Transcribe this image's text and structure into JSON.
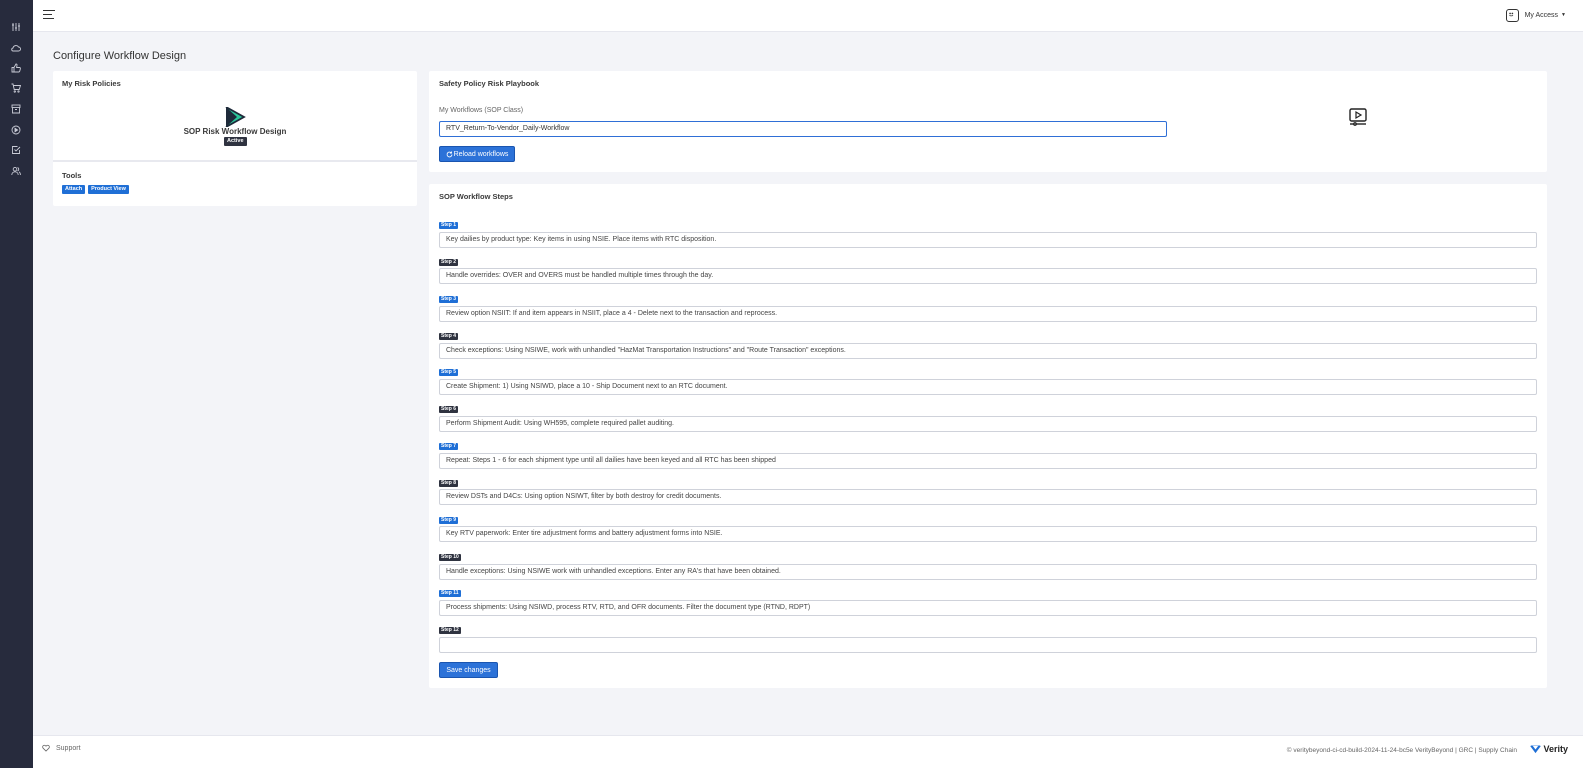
{
  "header": {
    "access_label": "My Access"
  },
  "page": {
    "title": "Configure Workflow Design"
  },
  "policies_card": {
    "title": "My Risk Policies",
    "policy_name": "SOP Risk Workflow Design",
    "policy_status": "Active",
    "tools_title": "Tools",
    "tools": [
      "Attach",
      "Product View"
    ]
  },
  "playbook_card": {
    "title": "Safety Policy Risk Playbook",
    "workflows_label": "My Workflows (SOP Class)",
    "workflow_value": "RTV_Return-To-Vendor_Daily-Workflow",
    "reload_label": "Reload workflows"
  },
  "steps_card": {
    "title": "SOP Workflow Steps",
    "save_label": "Save changes",
    "steps": [
      {
        "label": "Step 1",
        "text": "Key dailies by product type: Key items in using NSIE. Place items with RTC disposition."
      },
      {
        "label": "Step 2",
        "text": "Handle overrides: OVER and OVERS must be handled multiple times through the day."
      },
      {
        "label": "Step 3",
        "text": "Review option NSIIT: If and item appears in NSIIT, place a 4 - Delete next to the transaction and reprocess."
      },
      {
        "label": "Step 4",
        "text": "Check exceptions: Using NSIWE, work with unhandled \"HazMat Transportation Instructions\" and \"Route Transaction\" exceptions."
      },
      {
        "label": "Step 5",
        "text": "Create Shipment: 1) Using NSIWD, place a 10 - Ship Document next to an RTC document."
      },
      {
        "label": "Step 6",
        "text": "Perform Shipment Audit: Using WH595, complete required pallet auditing."
      },
      {
        "label": "Step 7",
        "text": "Repeat: Steps 1 - 6 for each shipment type until all dailies have been keyed and all RTC has been shipped"
      },
      {
        "label": "Step 8",
        "text": "Review DSTs and D4Cs: Using option NSIWT, filter by both destroy for credit documents."
      },
      {
        "label": "Step 9",
        "text": "Key RTV paperwork: Enter tire adjustment forms and battery adjustment forms into NSIE."
      },
      {
        "label": "Step 10",
        "text": "Handle exceptions: Using NSIWE work with unhandled exceptions. Enter any RA's that have been obtained."
      },
      {
        "label": "Step 11",
        "text": "Process shipments: Using NSIWD, process RTV, RTD, and OFR documents. Filter the document type (RTND, RDPT)"
      },
      {
        "label": "Step 12",
        "text": ""
      }
    ]
  },
  "footer": {
    "support_label": "Support",
    "copyright": "© veritybeyond-ci-cd-build-2024-11-24-bc5e VerityBeyond | GRC | Supply Chain",
    "brand": "Verity"
  },
  "colors": {
    "accent": "#2c72d8",
    "sidebar": "#272b3d",
    "badge_dark": "#2f3340",
    "logo_green": "#29c79a"
  },
  "icons": {
    "sidebar": [
      "sliders-icon",
      "cloud-icon",
      "thumbs-up-icon",
      "cart-icon",
      "archive-icon",
      "play-circle-icon",
      "check-square-icon",
      "users-icon"
    ],
    "header": [
      "hamburger-menu-icon",
      "smile-face-icon",
      "chevron-down-icon"
    ],
    "playbook": [
      "refresh-icon",
      "video-play-icon"
    ],
    "footer": [
      "heart-icon",
      "verity-logo-icon"
    ]
  }
}
